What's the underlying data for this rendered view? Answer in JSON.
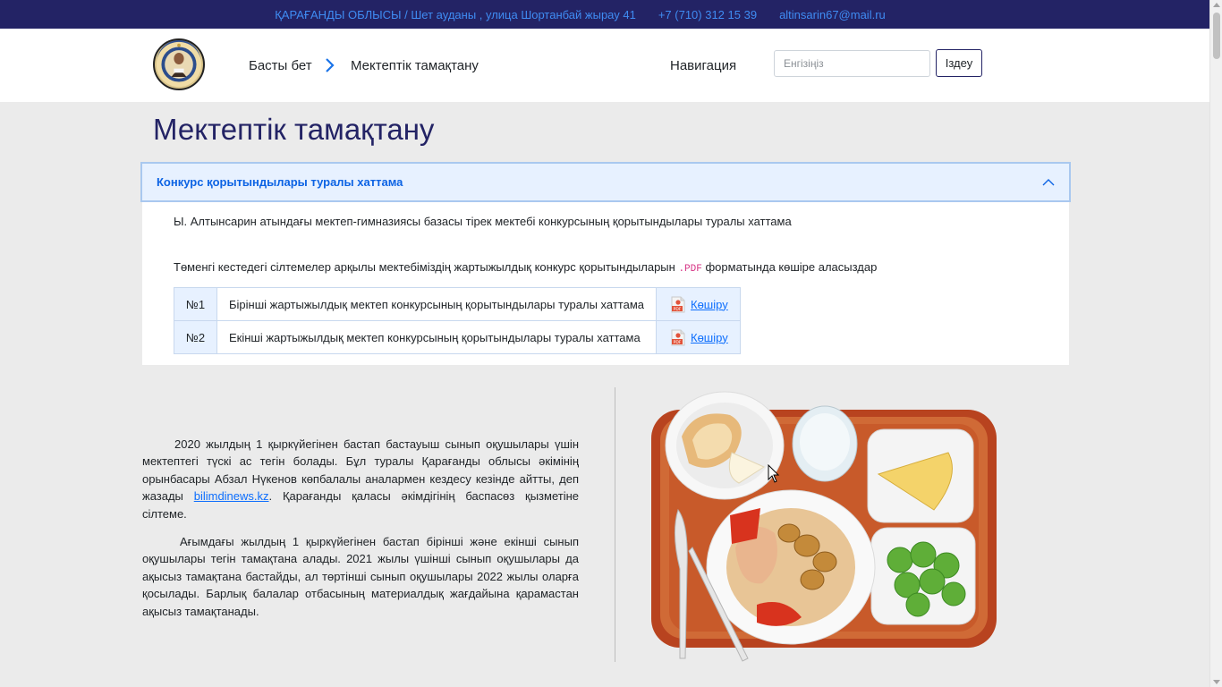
{
  "topbar": {
    "address": "ҚАРАҒАНДЫ ОБЛЫСЫ / Шет ауданы , улица Шортанбай жырау 41",
    "phone": "+7 (710) 312 15 39",
    "email": "altinsarin67@mail.ru"
  },
  "header": {
    "logo_icon": "school-emblem-icon",
    "breadcrumb": {
      "home": "Басты бет",
      "separator_icon": "chevron-right-icon",
      "current": "Мектептік тамақтану"
    },
    "nav_label": "Навигация",
    "search": {
      "placeholder": "Енгізіңіз",
      "value": "",
      "button_label": "Іздеу"
    }
  },
  "page": {
    "title": "Мектептік тамақтану"
  },
  "accordion": {
    "title": "Конкурс қорытындылары туралы хаттама",
    "expanded": true,
    "chevron_icon": "chevron-up-icon",
    "intro": "Ы. Алтынсарин атындағы мектеп-гимназиясы базасы тірек мектебі конкурсының қорытындылары туралы хаттама",
    "note_before": "Төменгі кестедегі сілтемелер арқылы мектебіміздің жартыжылдық конкурс қорытындыларын",
    "note_code": ".PDF",
    "note_after": "форматында көшіре аласыздар",
    "downloads": [
      {
        "num": "№1",
        "title": "Бірінші жартыжылдық мектеп конкурсының қорытындылары туралы хаттама",
        "link": "Көшіру",
        "icon": "pdf-file-icon"
      },
      {
        "num": "№2",
        "title": "Екінші жартыжылдық мектеп конкурсының қорытындылары туралы хаттама",
        "link": "Көшіру",
        "icon": "pdf-file-icon"
      }
    ]
  },
  "article": {
    "p1_before": "2020 жылдың 1 қыркүйегінен бастап бастауыш сынып оқушылары үшін мектептегі түскі ас тегін болады. Бұл туралы Қарағанды облысы әкімінің орынбасары Абзал Нүкенов көпбалалы аналармен кездесу кезінде айтты, деп жазады",
    "p1_link": "bilimdinews.kz",
    "p1_after": ". Қарағанды қаласы әкімдігінің баспасөз қызметіне сілтеме.",
    "p2": "Ағымдағы жылдың 1 қыркүйегінен бастап бірінші және екінші сынып оқушылары тегін тамақтана алады. 2021 жылы үшінші сынып оқушылары да ақысыз тамақтана бастайды, ал төртінші сынып оқушылары 2022 жылы оларға қосылады. Барлық балалар отбасының материалдық жағдайына қарамастан ақысыз тамақтанады."
  },
  "image": {
    "subject": "school-lunch-tray-image"
  },
  "colors": {
    "topbar_bg": "#232365",
    "topbar_text": "#3f8cf3",
    "accent": "#0c63e4",
    "accordion_bg": "#e7f1ff",
    "page_bg": "#ebebeb"
  }
}
